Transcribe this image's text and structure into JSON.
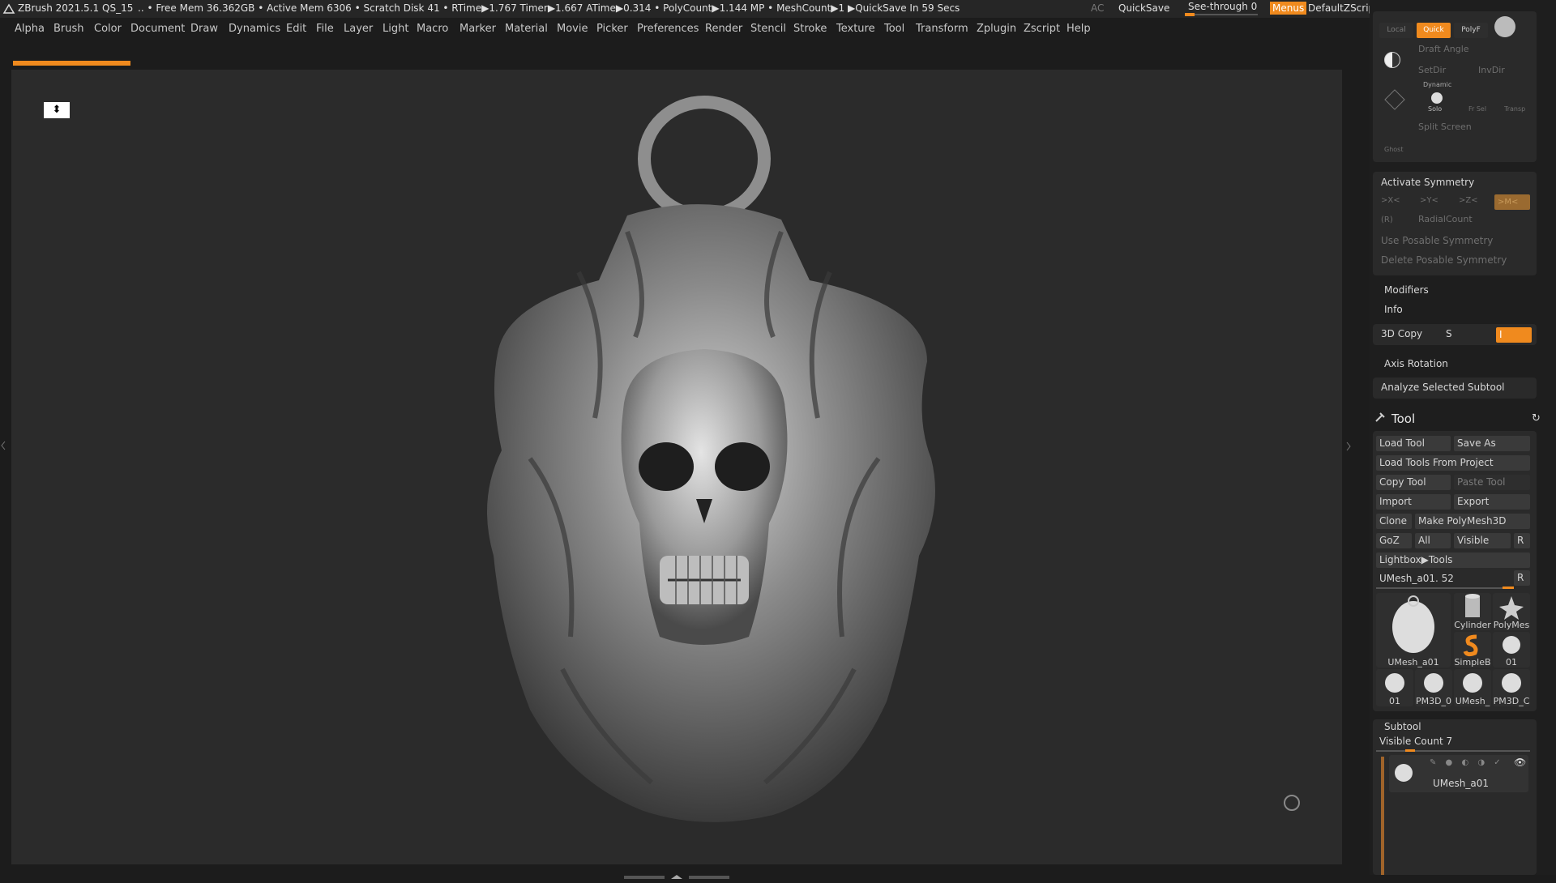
{
  "titlebar": {
    "app": "ZBrush 2021.5.1",
    "project": "QS_15",
    "stats": ".. • Free Mem 36.362GB • Active Mem 6306 • Scratch Disk 41 •  RTime▶1.767 Timer▶1.667 ATime▶0.314 • PolyCount▶1.144 MP  • MeshCount▶1  ▶QuickSave In 59 Secs",
    "ac": "AC",
    "quicksave": "QuickSave",
    "see_through": "See-through  0",
    "menus": "Menus",
    "script": "DefaultZScript"
  },
  "menu": [
    "Alpha",
    "Brush",
    "Color",
    "Document",
    "Draw",
    "Dynamics",
    "Edit",
    "File",
    "Layer",
    "Light",
    "Macro",
    "Marker",
    "Material",
    "Movie",
    "Picker",
    "Preferences",
    "Render",
    "Stencil",
    "Stroke",
    "Texture",
    "Tool",
    "Transform",
    "Zplugin",
    "Zscript",
    "Help"
  ],
  "progress": 0.09,
  "transform": {
    "local": "Local",
    "quick": "Quick",
    "polyf": "PolyF",
    "draft_angle": "Draft Angle",
    "setdir": "SetDir",
    "invdir": "InvDir",
    "dynamic": "Dynamic",
    "solo": "Solo",
    "frsel": "Fr Sel",
    "transp": "Transp",
    "split_screen": "Split Screen",
    "ghost": "Ghost"
  },
  "symmetry": {
    "activate": "Activate Symmetry",
    "x": ">X<",
    "y": ">Y<",
    "z": ">Z<",
    "m": ">M<",
    "r": "(R)",
    "radial": "RadialCount",
    "use_posable": "Use Posable Symmetry",
    "delete_posable": "Delete Posable Symmetry"
  },
  "modifiers": "Modifiers",
  "info": "Info",
  "copy3d": {
    "label": "3D Copy",
    "s": "S",
    "i": "I"
  },
  "axis_rotation": "Axis Rotation",
  "analyze": "Analyze Selected Subtool",
  "tool": {
    "title": "Tool",
    "load": "Load Tool",
    "save_as": "Save As",
    "load_project": "Load Tools From Project",
    "copy": "Copy Tool",
    "paste": "Paste Tool",
    "import": "Import",
    "export": "Export",
    "clone": "Clone",
    "make_polymesh": "Make PolyMesh3D",
    "goz": "GoZ",
    "all": "All",
    "visible": "Visible",
    "r": "R",
    "lightbox": "Lightbox▶Tools",
    "current": "UMesh_a01. 52",
    "current_r": "R",
    "thumbs": {
      "main": "UMesh_a01",
      "cylinder": "Cylinder",
      "polymesh": "PolyMes",
      "simpleb": "SimpleB",
      "t01a": "01",
      "t01b": "01",
      "pm3d_a": "PM3D_0",
      "umesh": "UMesh_",
      "pm3d_b": "PM3D_C"
    }
  },
  "subtool": {
    "title": "Subtool",
    "visible_count": "Visible Count 7",
    "item": "UMesh_a01"
  },
  "colors": {
    "accent": "#f08a1e",
    "canvas": "#2b2b2b",
    "panel": "#1e1e1e"
  }
}
